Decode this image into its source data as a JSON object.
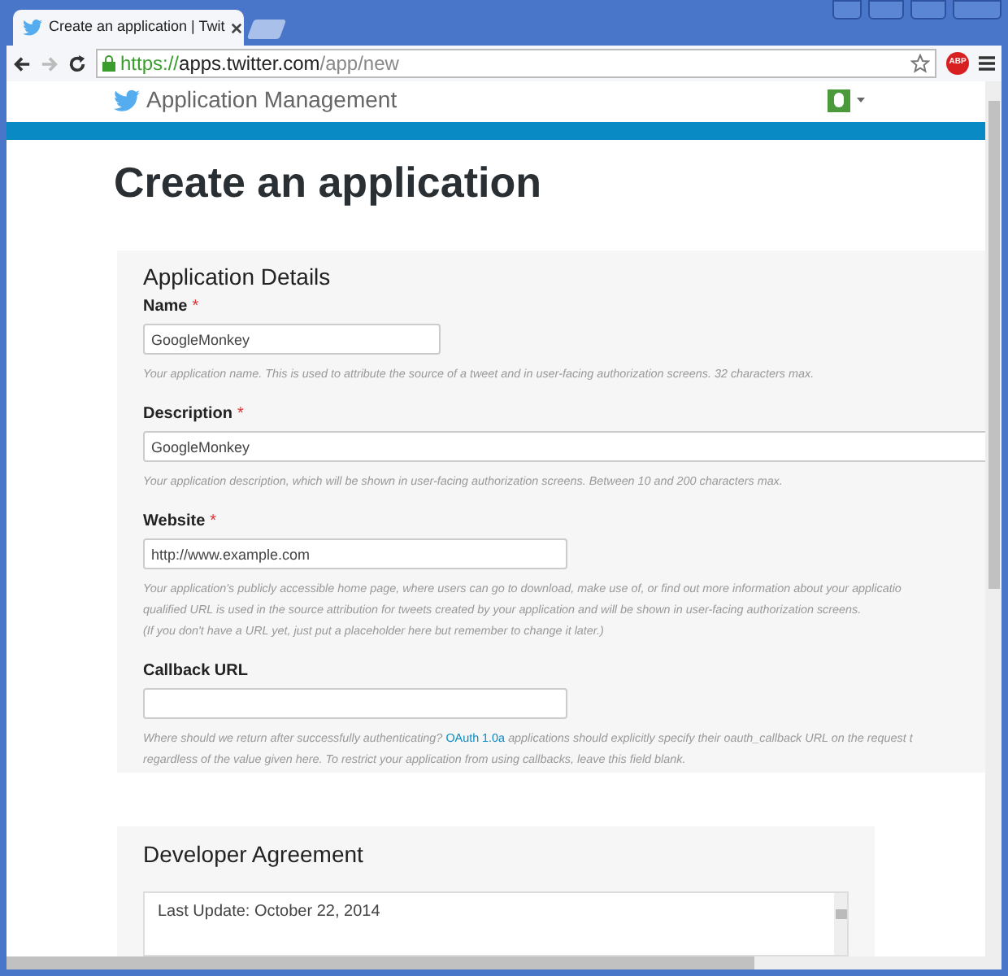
{
  "browser": {
    "tab_title": "Create an application | Twit",
    "url": {
      "scheme": "https://",
      "host": "apps.twitter.com",
      "path": "/app/new"
    },
    "extension_badge": "ABP"
  },
  "header": {
    "title": "Application Management"
  },
  "page_title": "Create an application",
  "details": {
    "heading": "Application Details",
    "fields": [
      {
        "label": "Name",
        "required_mark": "*",
        "value": "GoogleMonkey",
        "help": [
          {
            "text": "Your application name. This is used to attribute the source of a tweet and in user-facing authorization screens. 32 characters max."
          }
        ]
      },
      {
        "label": "Description",
        "required_mark": "*",
        "value": "GoogleMonkey",
        "help": [
          {
            "text": "Your application description, which will be shown in user-facing authorization screens. Between 10 and 200 characters max."
          }
        ]
      },
      {
        "label": "Website",
        "required_mark": "*",
        "value": "http://www.example.com",
        "help": [
          {
            "text": "Your application's publicly accessible home page, where users can go to download, make use of, or find out more information about your applicatio"
          },
          {
            "text": "qualified URL is used in the source attribution for tweets created by your application and will be shown in user-facing authorization screens."
          },
          {
            "text": "(If you don't have a URL yet, just put a placeholder here but remember to change it later.)"
          }
        ]
      },
      {
        "label": "Callback URL",
        "help": [
          {
            "text": "Where should we return after successfully authenticating?",
            "link": "OAuth 1.0a",
            "after": "applications should explicitly specify their oauth_callback URL on the request t"
          },
          {
            "text": "regardless of the value given here. To restrict your application from using callbacks, leave this field blank."
          }
        ]
      }
    ]
  },
  "agreement": {
    "heading": "Developer Agreement",
    "text": "Last Update: October 22, 2014"
  }
}
